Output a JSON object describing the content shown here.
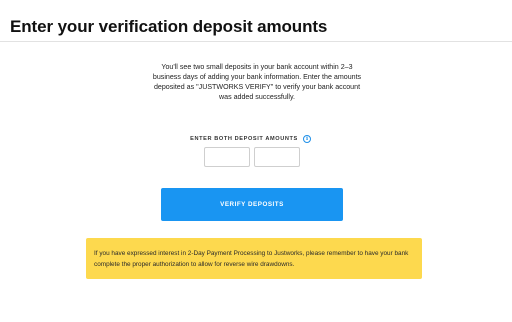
{
  "header": {
    "title": "Enter your verification deposit amounts"
  },
  "main": {
    "description": "You'll see two small deposits in your bank account within 2–3 business days of adding your bank information. Enter the amounts deposited as \"JUSTWORKS VERIFY\" to verify your bank account was added successfully.",
    "amounts_label": "ENTER BOTH DEPOSIT AMOUNTS",
    "info_icon": "info-icon",
    "deposit_1": {
      "value": "",
      "placeholder": ""
    },
    "deposit_2": {
      "value": "",
      "placeholder": ""
    },
    "verify_button_label": "VERIFY DEPOSITS",
    "notice": "If you have expressed interest in 2-Day Payment Processing to Justworks, please remember to have your bank complete the proper authorization to allow for reverse wire drawdowns."
  },
  "colors": {
    "accent": "#1995f2",
    "notice_background": "#fdd94e"
  }
}
